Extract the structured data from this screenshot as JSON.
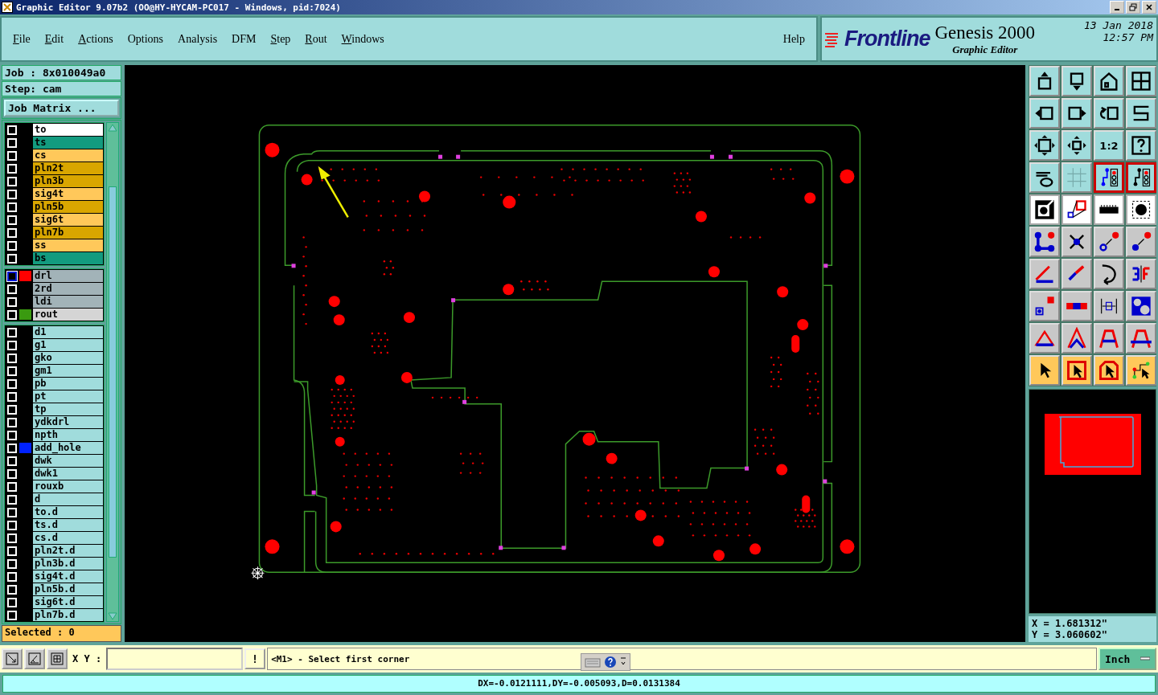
{
  "window": {
    "title": "Graphic Editor 9.07b2 (OO@HY-HYCAM-PC017 - Windows, pid:7024)"
  },
  "menu": [
    {
      "label": "File",
      "underline": true
    },
    {
      "label": "Edit",
      "underline": true
    },
    {
      "label": "Actions",
      "underline": true
    },
    {
      "label": "Options",
      "underline": false
    },
    {
      "label": "Analysis",
      "underline": false
    },
    {
      "label": "DFM",
      "underline": false
    },
    {
      "label": "Step",
      "underline": true
    },
    {
      "label": "Rout",
      "underline": true
    },
    {
      "label": "Windows",
      "underline": true
    }
  ],
  "help": "Help",
  "brand": {
    "logo": "Frontline",
    "product": "Genesis 2000",
    "subtitle": "Graphic Editor",
    "date": "13 Jan 2018",
    "time": "12:57 PM"
  },
  "job": {
    "job": "Job : 8x010049a0",
    "step": "Step: cam",
    "matrix_button": "Job Matrix ..."
  },
  "layer_groups": [
    {
      "layers": [
        {
          "name": "to",
          "color": "#ffffff",
          "affected": false
        },
        {
          "name": "ts",
          "color": "#139b7f",
          "affected": false
        },
        {
          "name": "cs",
          "color": "#ffc85a",
          "affected": false
        },
        {
          "name": "pln2t",
          "color": "#d9a600",
          "affected": false
        },
        {
          "name": "pln3b",
          "color": "#d9a600",
          "affected": false
        },
        {
          "name": "sig4t",
          "color": "#ffc85a",
          "affected": false
        },
        {
          "name": "pln5b",
          "color": "#d9a600",
          "affected": false
        },
        {
          "name": "sig6t",
          "color": "#ffc85a",
          "affected": false
        },
        {
          "name": "pln7b",
          "color": "#d9a600",
          "affected": false
        },
        {
          "name": "ss",
          "color": "#ffc85a",
          "affected": false
        },
        {
          "name": "bs",
          "color": "#139b7f",
          "affected": false
        }
      ]
    },
    {
      "layers": [
        {
          "name": "drl",
          "color": "#a2b3b8",
          "affected": true,
          "swatch": {
            "color": "#ff0000"
          }
        },
        {
          "name": "2rd",
          "color": "#a2b3b8",
          "affected": false
        },
        {
          "name": "ldi",
          "color": "#a2b3b8",
          "affected": false
        },
        {
          "name": "rout",
          "color": "#d5d5d5",
          "affected": false,
          "swatch": {
            "color": "#3a9a10"
          }
        }
      ]
    },
    {
      "layers": [
        {
          "name": "d1",
          "color": "#a0dcdc",
          "affected": false
        },
        {
          "name": "g1",
          "color": "#a0dcdc",
          "affected": false
        },
        {
          "name": "gko",
          "color": "#a0dcdc",
          "affected": false
        },
        {
          "name": "gm1",
          "color": "#a0dcdc",
          "affected": false
        },
        {
          "name": "pb",
          "color": "#a0dcdc",
          "affected": false
        },
        {
          "name": "pt",
          "color": "#a0dcdc",
          "affected": false
        },
        {
          "name": "tp",
          "color": "#a0dcdc",
          "affected": false
        },
        {
          "name": "ydkdrl",
          "color": "#a0dcdc",
          "affected": false
        },
        {
          "name": "npth",
          "color": "#a0dcdc",
          "affected": false
        },
        {
          "name": "add_hole",
          "color": "#a0dcdc",
          "affected": false,
          "swatch": {
            "color": "#0022ff"
          }
        },
        {
          "name": "dwk",
          "color": "#a0dcdc",
          "affected": false
        },
        {
          "name": "dwk1",
          "color": "#a0dcdc",
          "affected": false
        },
        {
          "name": "rouxb",
          "color": "#a0dcdc",
          "affected": false
        },
        {
          "name": "d",
          "color": "#a0dcdc",
          "affected": false
        },
        {
          "name": "to.d",
          "color": "#a0dcdc",
          "affected": false
        },
        {
          "name": "ts.d",
          "color": "#a0dcdc",
          "affected": false
        },
        {
          "name": "cs.d",
          "color": "#a0dcdc",
          "affected": false
        },
        {
          "name": "pln2t.d",
          "color": "#a0dcdc",
          "affected": false
        },
        {
          "name": "pln3b.d",
          "color": "#a0dcdc",
          "affected": false
        },
        {
          "name": "sig4t.d",
          "color": "#a0dcdc",
          "affected": false
        },
        {
          "name": "pln5b.d",
          "color": "#a0dcdc",
          "affected": false
        },
        {
          "name": "sig6t.d",
          "color": "#a0dcdc",
          "affected": false
        },
        {
          "name": "pln7b.d",
          "color": "#a0dcdc",
          "affected": false
        }
      ]
    }
  ],
  "selected_count": "Selected : 0",
  "toolbar": [
    {
      "kind": "plain"
    },
    {
      "kind": "plain"
    },
    {
      "kind": "plain"
    },
    {
      "kind": "plain"
    },
    {
      "kind": "plain"
    },
    {
      "kind": "plain"
    },
    {
      "kind": "plain"
    },
    {
      "kind": "plain"
    },
    {
      "kind": "plain"
    },
    {
      "kind": "plain"
    },
    {
      "kind": "plain",
      "label": "1:2"
    },
    {
      "kind": "plain"
    },
    {
      "kind": "plain"
    },
    {
      "kind": "plain"
    },
    {
      "kind": "alert"
    },
    {
      "kind": "alert"
    },
    {
      "kind": "white"
    },
    {
      "kind": "white"
    },
    {
      "kind": "white"
    },
    {
      "kind": "white"
    },
    {
      "kind": "gray"
    },
    {
      "kind": "gray"
    },
    {
      "kind": "gray"
    },
    {
      "kind": "gray"
    },
    {
      "kind": "gray"
    },
    {
      "kind": "gray"
    },
    {
      "kind": "gray"
    },
    {
      "kind": "gray"
    },
    {
      "kind": "gray"
    },
    {
      "kind": "gray"
    },
    {
      "kind": "gray"
    },
    {
      "kind": "gray"
    },
    {
      "kind": "gray"
    },
    {
      "kind": "gray"
    },
    {
      "kind": "gray"
    },
    {
      "kind": "gray"
    },
    {
      "kind": "select"
    },
    {
      "kind": "select"
    },
    {
      "kind": "select"
    },
    {
      "kind": "select"
    }
  ],
  "coordinates": {
    "x": "X = 1.681312\"",
    "y": "Y = 3.060602\""
  },
  "command_bar": {
    "xy_label": "X Y :",
    "warning_button": "!",
    "message": "<M1> - Select first corner",
    "units": "Inch"
  },
  "status_bar": "DX=-0.0121111,DY=-0.005093,D=0.0131384"
}
